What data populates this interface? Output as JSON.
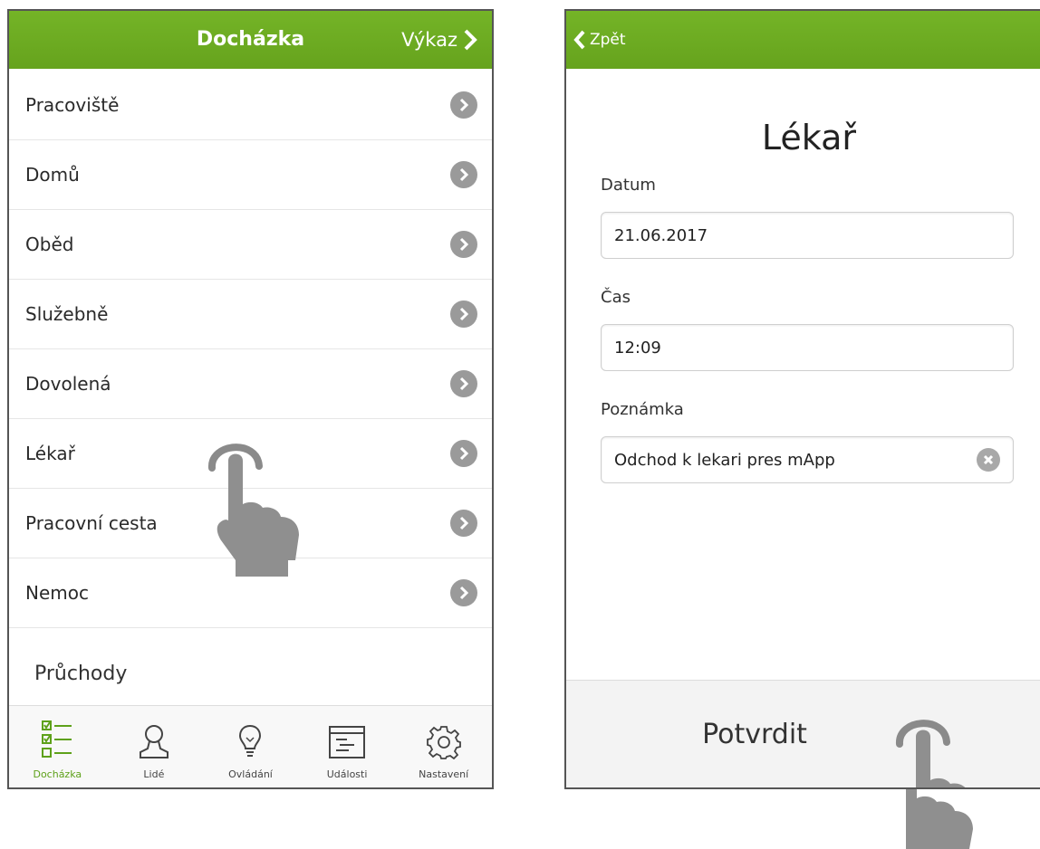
{
  "left_screen": {
    "header": {
      "title": "Docházka",
      "action_label": "Výkaz"
    },
    "items": [
      {
        "label": "Pracoviště"
      },
      {
        "label": "Domů"
      },
      {
        "label": "Oběd"
      },
      {
        "label": "Služebně"
      },
      {
        "label": "Dovolená"
      },
      {
        "label": "Lékař"
      },
      {
        "label": "Pracovní cesta"
      },
      {
        "label": "Nemoc"
      }
    ],
    "section_label": "Průchody",
    "tabs": [
      {
        "label": "Docházka",
        "icon": "checklist-icon",
        "active": true
      },
      {
        "label": "Lidé",
        "icon": "person-icon",
        "active": false
      },
      {
        "label": "Ovládání",
        "icon": "lightbulb-icon",
        "active": false
      },
      {
        "label": "Události",
        "icon": "events-icon",
        "active": false
      },
      {
        "label": "Nastavení",
        "icon": "gear-icon",
        "active": false
      }
    ]
  },
  "right_screen": {
    "header": {
      "back_label": "Zpět"
    },
    "title": "Lékař",
    "fields": {
      "date": {
        "label": "Datum",
        "value": "21.06.2017"
      },
      "time": {
        "label": "Čas",
        "value": "12:09"
      },
      "note": {
        "label": "Poznámka",
        "value": "Odchod k lekari pres mApp"
      }
    },
    "confirm_label": "Potvrdit"
  },
  "colors": {
    "accent": "#6aa920",
    "active_tab": "#5ea11a",
    "chevron": "#9a9a9a"
  }
}
